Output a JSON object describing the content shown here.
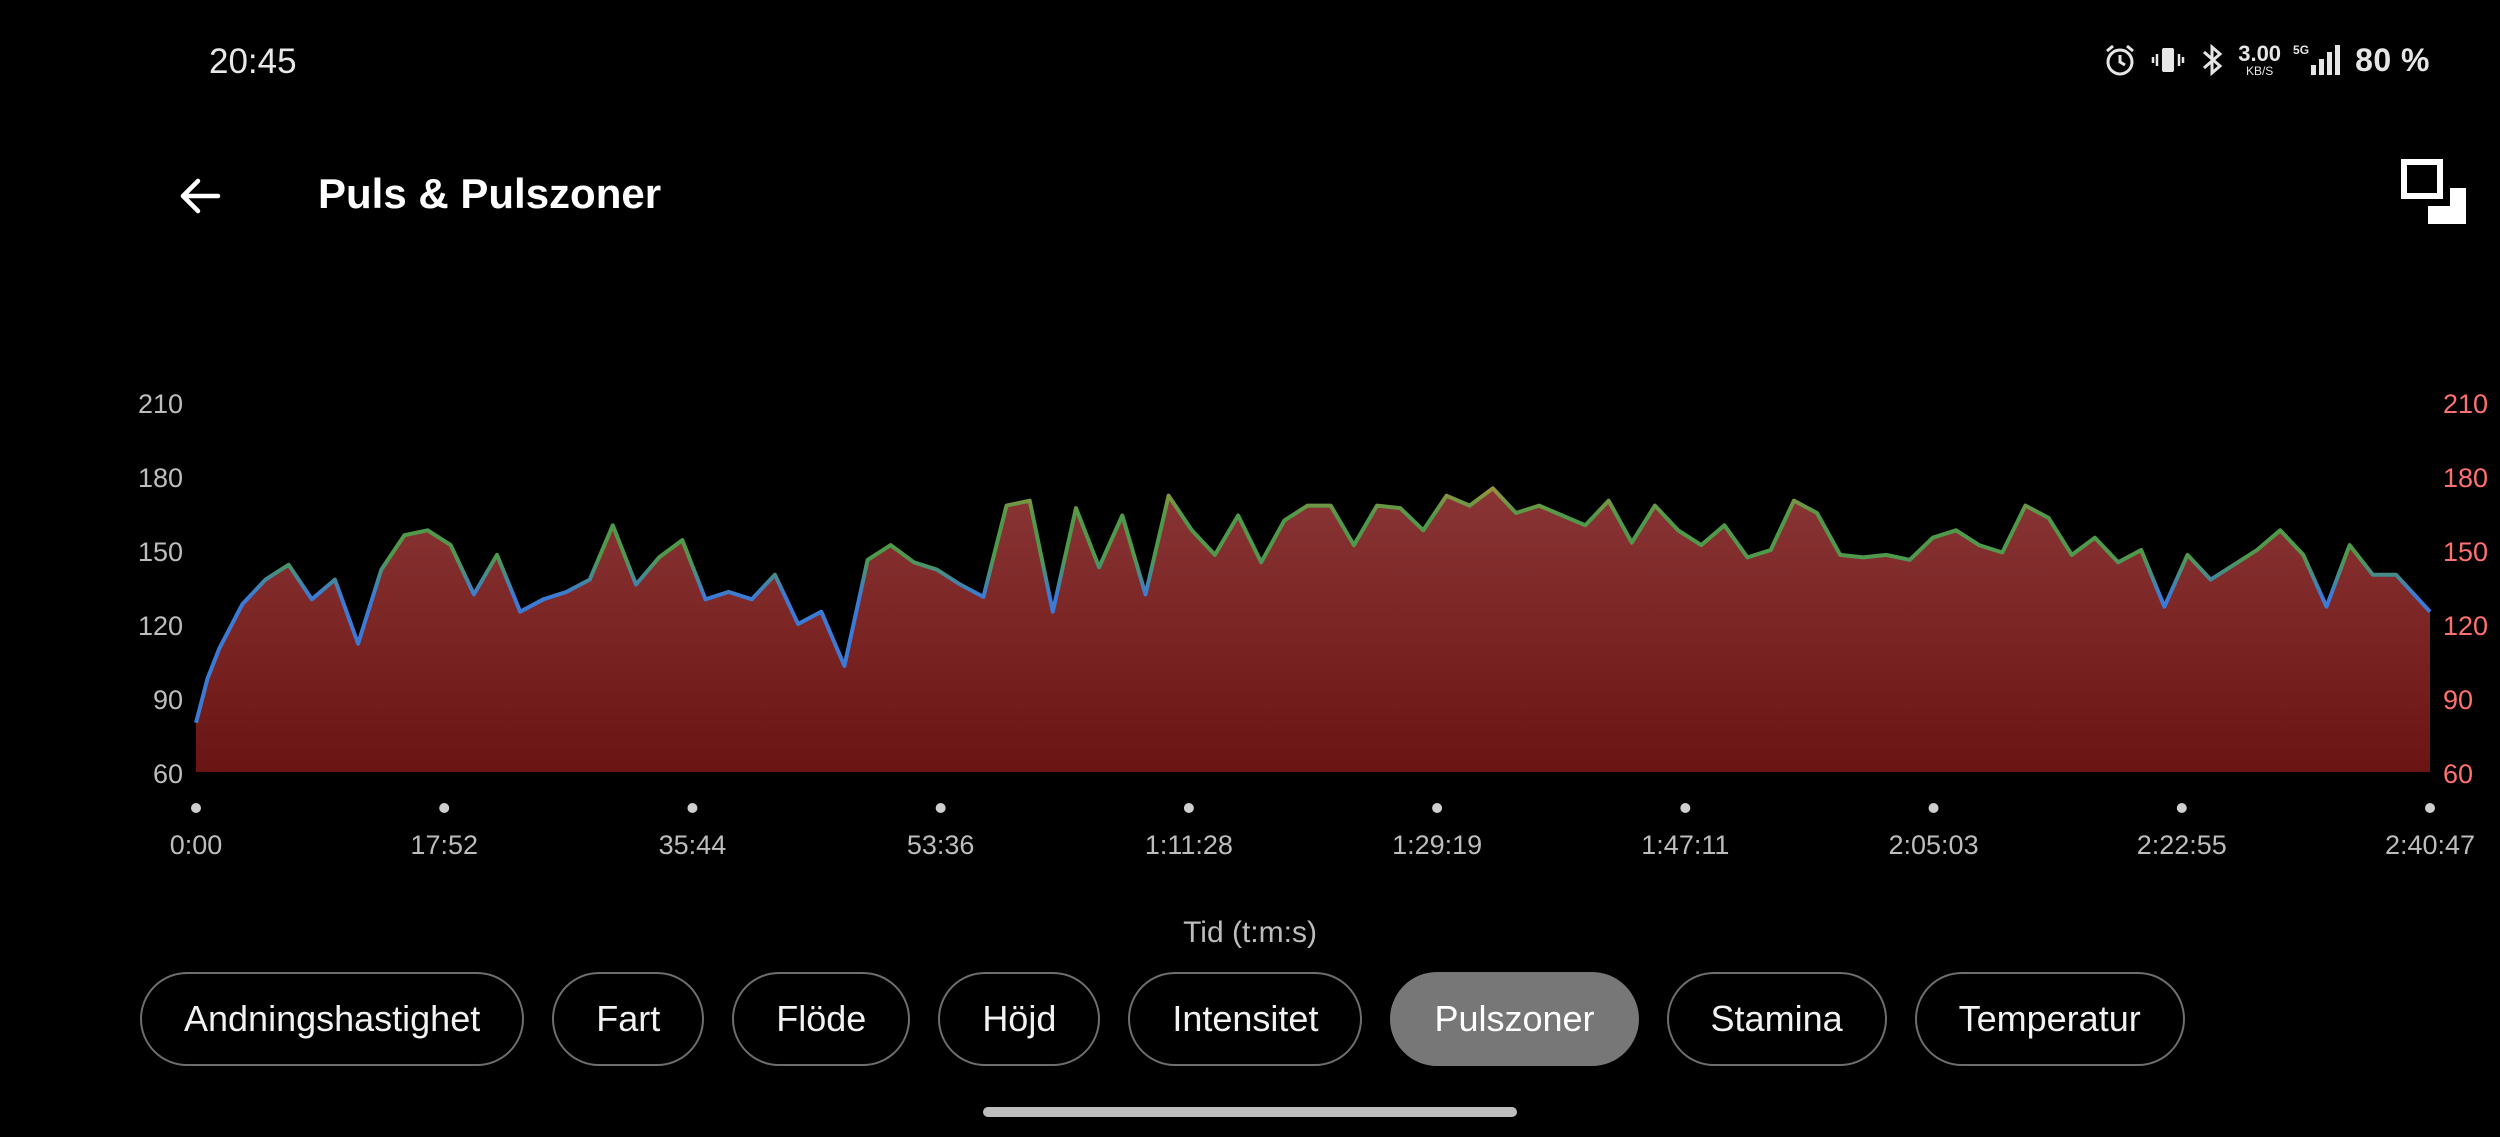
{
  "status_bar": {
    "time": "20:45",
    "net_speed_value": "3.00",
    "net_speed_unit": "KB/S",
    "network_tag": "5G",
    "battery": "80 %",
    "icons": [
      "alarm-icon",
      "vibrate-icon",
      "bluetooth-icon",
      "signal-icon"
    ]
  },
  "header": {
    "title": "Puls & Pulszoner",
    "back_icon": "arrow-left-icon",
    "rotate_icon": "screen-rotate-icon"
  },
  "chart_data": {
    "type": "area",
    "title": "",
    "xlabel": "Tid (t:m:s)",
    "ylabel": "",
    "ylim": [
      60,
      210
    ],
    "yticks": [
      "210",
      "180",
      "150",
      "120",
      "90",
      "60"
    ],
    "xticks": [
      "0:00",
      "17:52",
      "35:44",
      "53:36",
      "1:11:28",
      "1:29:19",
      "1:47:11",
      "2:05:03",
      "2:22:55",
      "2:40:47"
    ],
    "xlim_seconds": [
      0,
      9647
    ],
    "y_axes": "left and right",
    "grid": false,
    "colors": {
      "fill_top": "#8a3535",
      "fill_bottom": "#6b1414",
      "line_low": "#3b7bd6",
      "line_mid": "#4f9a4a",
      "line_high": "#e08a2e",
      "right_axis": "#ff7070"
    },
    "series": [
      {
        "x_seconds": [
          0,
          50,
          100,
          200,
          300,
          400,
          500,
          600,
          700,
          800,
          900,
          1000,
          1100,
          1200,
          1300,
          1400,
          1500,
          1600,
          1700,
          1800,
          1900,
          2000,
          2100,
          2200,
          2300,
          2400,
          2500,
          2600,
          2700,
          2800,
          2900,
          3000,
          3100,
          3200,
          3300,
          3400,
          3500,
          3600,
          3700,
          3800,
          3900,
          4000,
          4100,
          4200,
          4300,
          4400,
          4500,
          4600,
          4700,
          4800,
          4900,
          5000,
          5100,
          5200,
          5300,
          5400,
          5500,
          5600,
          5700,
          5800,
          5900,
          6000,
          6100,
          6200,
          6300,
          6400,
          6500,
          6600,
          6700,
          6800,
          6900,
          7000,
          7100,
          7200,
          7300,
          7400,
          7500,
          7600,
          7700,
          7800,
          7900,
          8000,
          8100,
          8200,
          8300,
          8400,
          8500,
          8600,
          8700,
          8800,
          8900,
          9000,
          9100,
          9200,
          9300,
          9400,
          9500,
          9647
        ],
        "y": [
          80,
          98,
          110,
          128,
          138,
          144,
          130,
          138,
          112,
          142,
          156,
          158,
          152,
          132,
          148,
          125,
          130,
          133,
          138,
          160,
          136,
          147,
          154,
          130,
          133,
          130,
          140,
          120,
          125,
          103,
          146,
          152,
          145,
          142,
          136,
          131,
          168,
          170,
          125,
          167,
          143,
          164,
          132,
          172,
          158,
          148,
          164,
          145,
          162,
          168,
          168,
          152,
          168,
          167,
          158,
          172,
          168,
          175,
          165,
          168,
          164,
          160,
          170,
          153,
          168,
          158,
          152,
          160,
          147,
          150,
          170,
          165,
          148,
          147,
          148,
          146,
          155,
          158,
          152,
          149,
          168,
          163,
          148,
          155,
          145,
          150,
          127,
          148,
          138,
          144,
          150,
          158,
          148,
          127,
          152,
          140,
          140,
          125
        ]
      }
    ]
  },
  "filter_chips": {
    "items": [
      "Andningshastighet",
      "Fart",
      "Flöde",
      "Höjd",
      "Intensitet",
      "Pulszoner",
      "Stamina",
      "Temperatur"
    ],
    "selected": "Pulszoner"
  }
}
